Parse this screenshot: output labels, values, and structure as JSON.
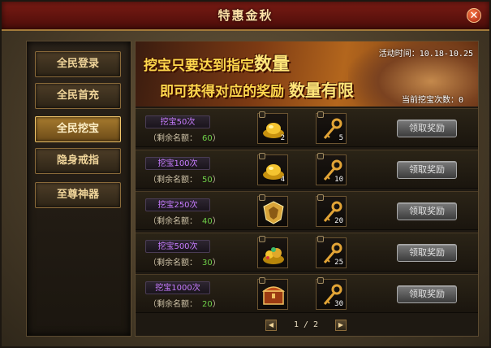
{
  "window": {
    "title": "特惠金秋",
    "close_glyph": "✕"
  },
  "sidebar": {
    "items": [
      {
        "label": "全民登录",
        "active": false
      },
      {
        "label": "全民首充",
        "active": false
      },
      {
        "label": "全民挖宝",
        "active": true
      },
      {
        "label": "隐身戒指",
        "active": false
      },
      {
        "label": "至尊神器",
        "active": false
      }
    ]
  },
  "banner": {
    "line1_prefix": "挖宝只要达到指定",
    "line1_emph": "数量",
    "line2_prefix": "即可获得对应的奖励",
    "line2_emph": "数量有限",
    "activity_time": "活动时间：10.18-10.25",
    "current_count": "当前挖宝次数：0"
  },
  "rewards": [
    {
      "tag": "挖宝50次",
      "remain_label": "（剩余名额：",
      "remain": "60",
      "remain_suffix": "）",
      "item1_icon": "gold-ingot-icon",
      "item1_qty": "2",
      "item2_icon": "key-icon",
      "item2_qty": "5",
      "button": "领取奖励"
    },
    {
      "tag": "挖宝100次",
      "remain_label": "（剩余名额：",
      "remain": "50",
      "remain_suffix": "）",
      "item1_icon": "gold-ingot-icon",
      "item1_qty": "4",
      "item2_icon": "key-icon",
      "item2_qty": "10",
      "button": "领取奖励"
    },
    {
      "tag": "挖宝250次",
      "remain_label": "（剩余名额：",
      "remain": "40",
      "remain_suffix": "）",
      "item1_icon": "gold-shield-icon",
      "item1_qty": "",
      "item2_icon": "key-icon",
      "item2_qty": "20",
      "button": "领取奖励"
    },
    {
      "tag": "挖宝500次",
      "remain_label": "（剩余名额：",
      "remain": "30",
      "remain_suffix": "）",
      "item1_icon": "treasure-pile-icon",
      "item1_qty": "",
      "item2_icon": "key-icon",
      "item2_qty": "25",
      "button": "领取奖励"
    },
    {
      "tag": "挖宝1000次",
      "remain_label": "（剩余名额：",
      "remain": "20",
      "remain_suffix": "）",
      "item1_icon": "treasure-chest-icon",
      "item1_qty": "",
      "item2_icon": "key-icon",
      "item2_qty": "30",
      "button": "领取奖励"
    }
  ],
  "pager": {
    "text": "1 / 2",
    "prev_glyph": "◀",
    "next_glyph": "▶"
  },
  "colors": {
    "tag_text": "#c77cff",
    "remain_value": "#6fd14a",
    "accent_gold": "#ffd84d"
  }
}
